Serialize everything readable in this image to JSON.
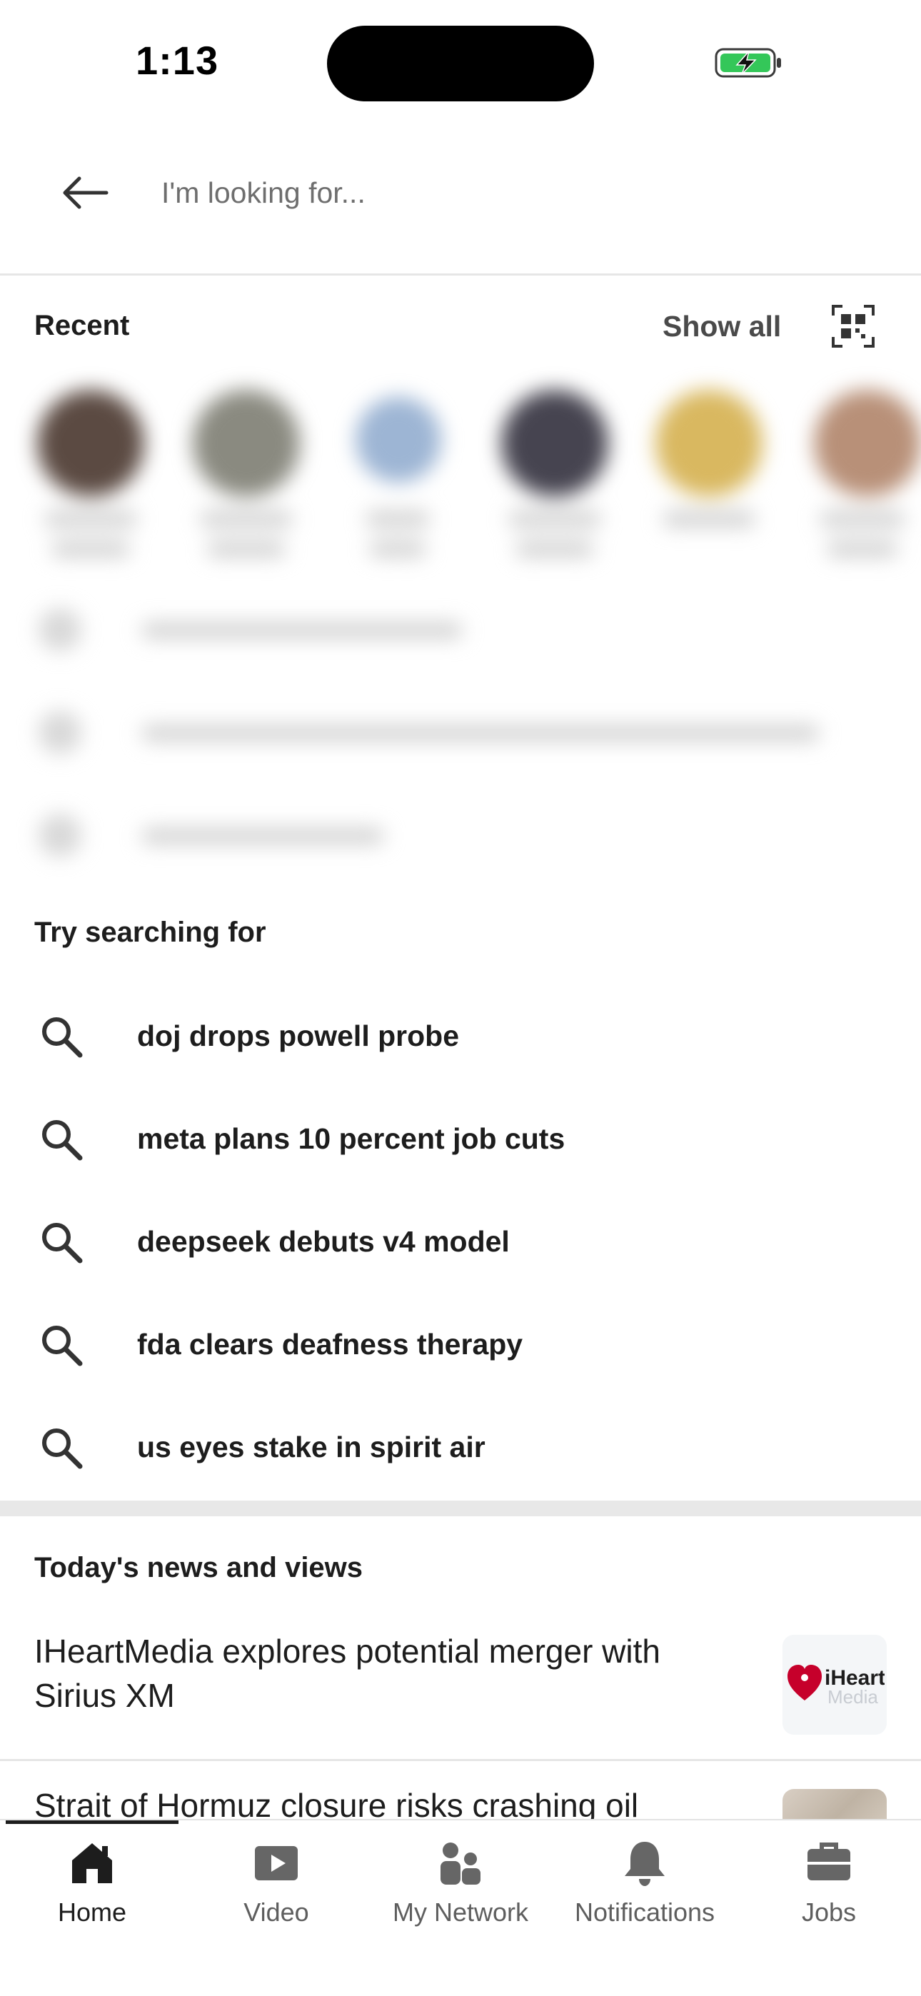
{
  "status_bar": {
    "time": "1:13",
    "battery_icon": "battery-charging-icon"
  },
  "search": {
    "placeholder": "I'm looking for..."
  },
  "recent": {
    "title": "Recent",
    "show_all_label": "Show all",
    "qr_icon": "qr-code-icon"
  },
  "try_searching": {
    "title": "Try searching for",
    "suggestions": [
      "doj drops powell probe",
      "meta plans 10 percent job cuts",
      "deepseek debuts v4 model",
      "fda clears deafness therapy",
      "us eyes stake in spirit air"
    ]
  },
  "news": {
    "title": "Today's news and views",
    "items": [
      {
        "headline": "IHeartMedia explores potential merger with Sirius XM",
        "thumb_text": "iHeart",
        "thumb_sub": "Media"
      },
      {
        "headline": "Strait of Hormuz closure risks crashing oil"
      }
    ]
  },
  "bottom_nav": {
    "items": [
      {
        "label": "Home",
        "icon": "home-icon",
        "active": true
      },
      {
        "label": "Video",
        "icon": "video-icon",
        "active": false
      },
      {
        "label": "My Network",
        "icon": "my-network-icon",
        "active": false
      },
      {
        "label": "Notifications",
        "icon": "bell-icon",
        "active": false
      },
      {
        "label": "Jobs",
        "icon": "briefcase-icon",
        "active": false
      }
    ]
  },
  "colors": {
    "text": "#1d1d1d",
    "muted": "#5e5e5e",
    "battery_green": "#34c759",
    "iheart_red": "#c6002b"
  }
}
